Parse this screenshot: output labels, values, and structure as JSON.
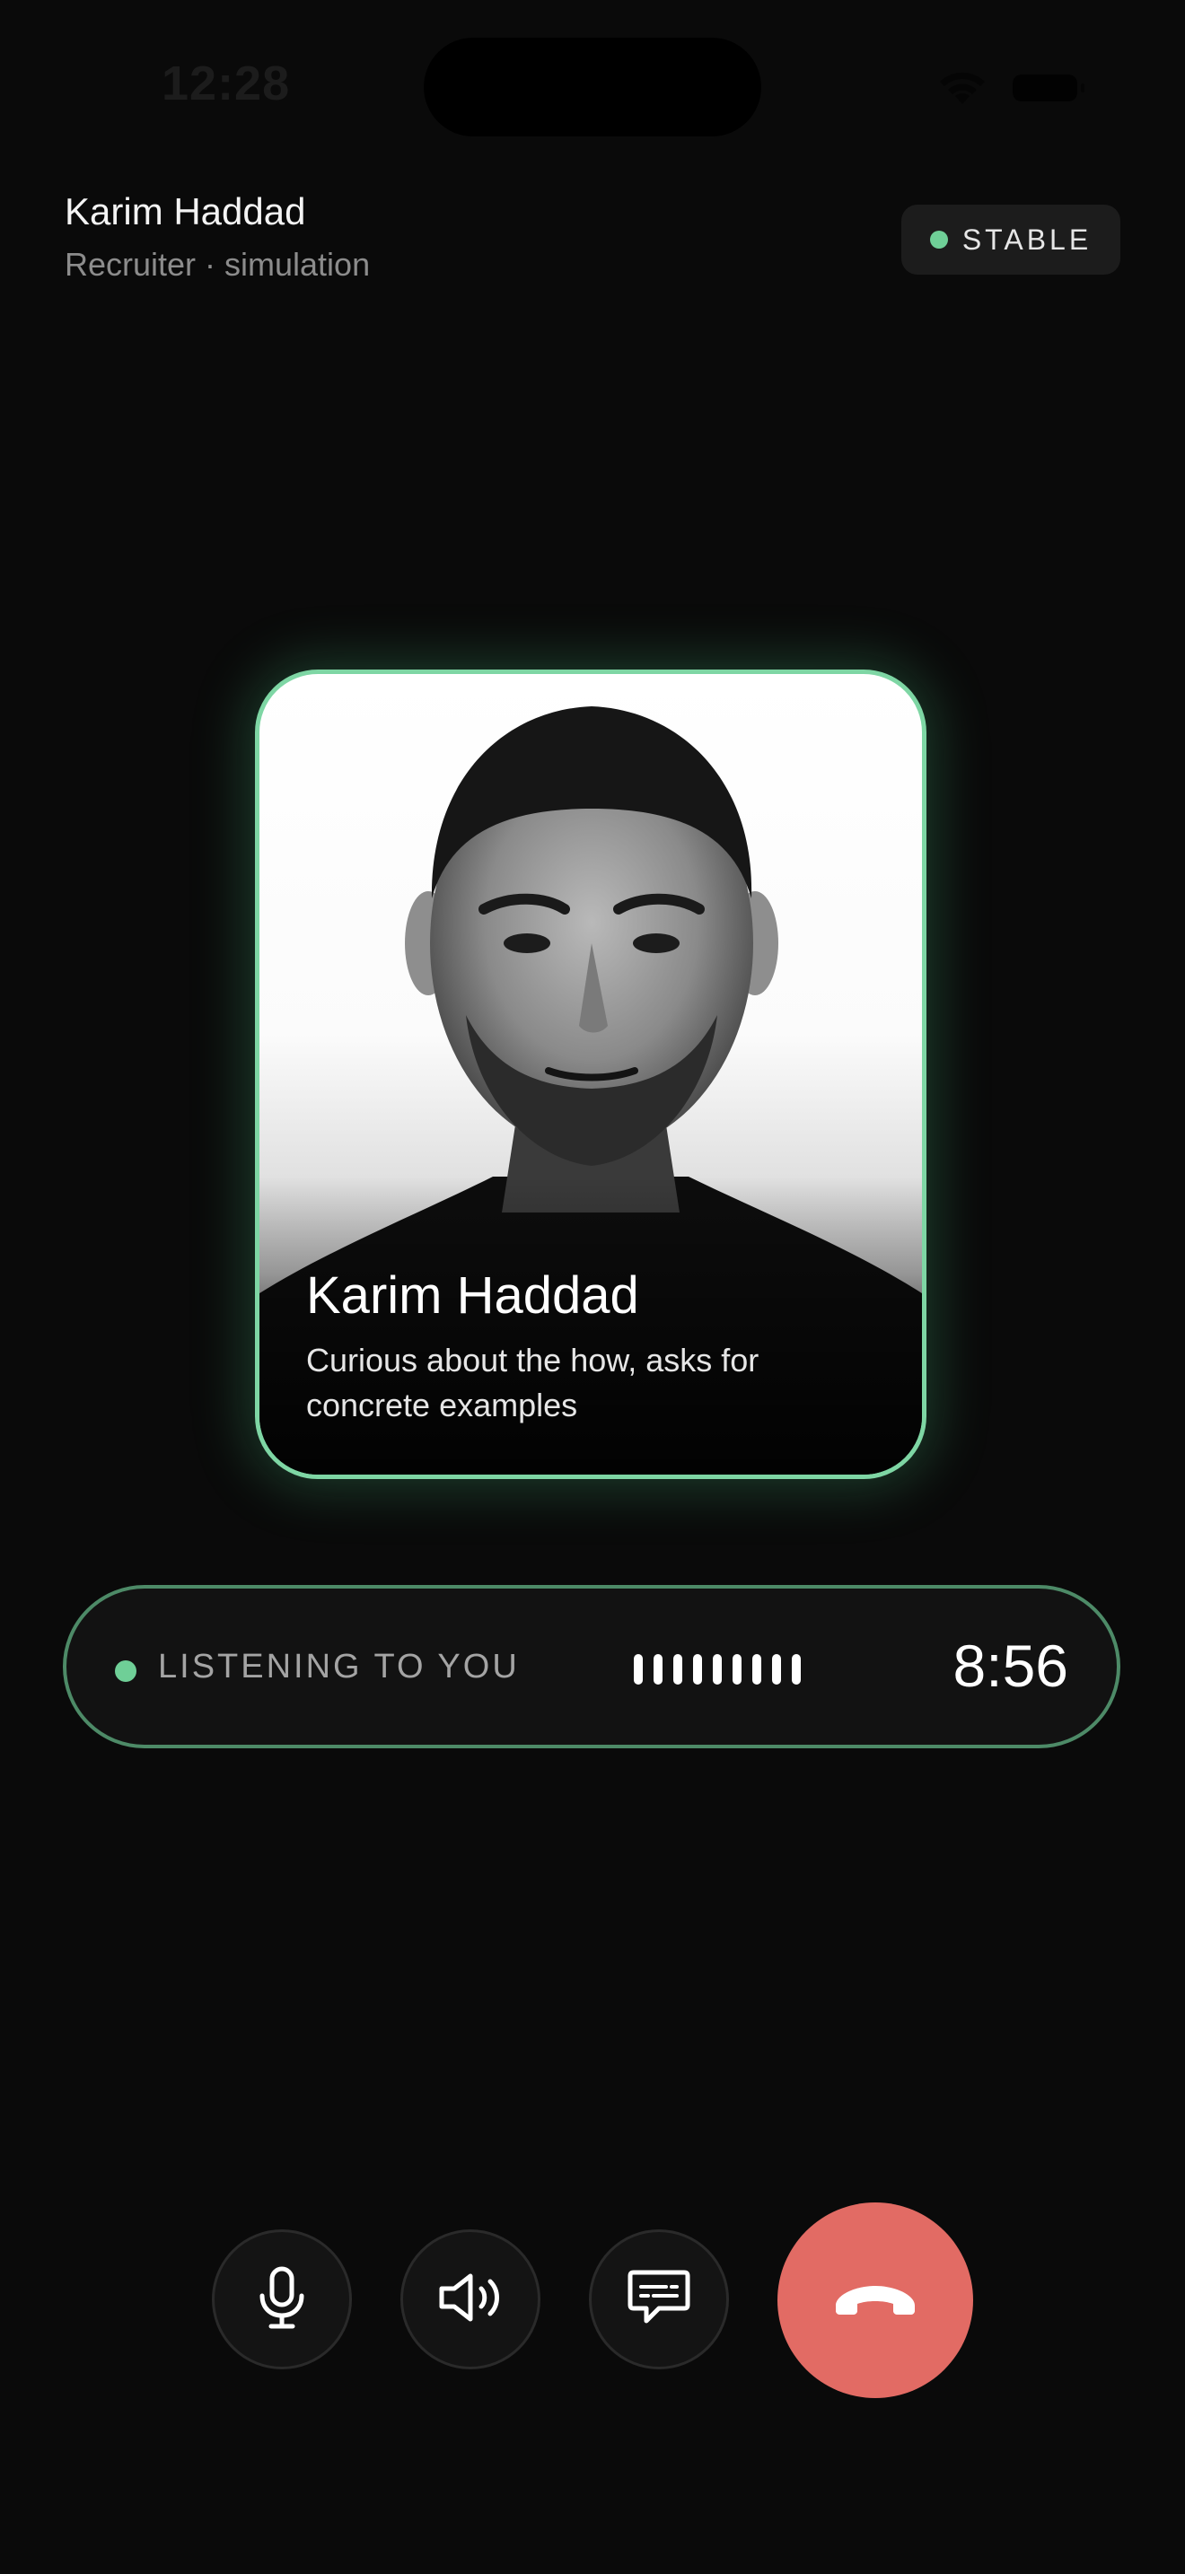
{
  "status_bar": {
    "time": "12:28"
  },
  "header": {
    "caller_name": "Karim Haddad",
    "caller_subtitle": "Recruiter · simulation",
    "connection_status": "STABLE"
  },
  "portrait": {
    "name": "Karim Haddad",
    "description": "Curious about the how, asks for concrete examples"
  },
  "listening": {
    "label": "LISTENING TO YOU",
    "timer": "8:56"
  },
  "controls": {
    "mic_icon": "microphone-icon",
    "speaker_icon": "speaker-icon",
    "captions_icon": "captions-icon",
    "end_call_icon": "phone-hangup-icon"
  },
  "colors": {
    "accent_green": "#6fcf97",
    "card_border": "#7ed6a4",
    "end_call_red": "#e26b64",
    "background": "#0a0a0a"
  }
}
